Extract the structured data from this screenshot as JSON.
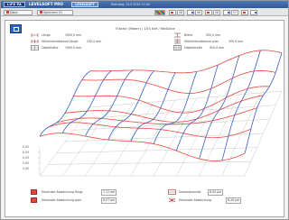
{
  "app": {
    "logo_text": "LIFE PA",
    "title": "LEVELSOFT PRO",
    "active_tab": "LEVELSOFT",
    "info": "Dienstag, 24.5.2016  11:04"
  },
  "toolbar": {
    "left_button": "Datei",
    "second_button": "Speichern",
    "second_value": "01",
    "num_fields": [
      "08",
      "06",
      "08",
      "07"
    ]
  },
  "workspace": {
    "title": "Fläche (Meter) / 155 tief / Meßlinie",
    "params_left": [
      {
        "label": "Länge",
        "value": "1995,0 mm"
      },
      {
        "label": "Stützlinienabstand Länge",
        "value": "230,0 mm"
      },
      {
        "label": "Objekthöhe",
        "value": "1995,0 mm"
      }
    ],
    "params_right": [
      {
        "label": "Breite",
        "value": "920,0 mm"
      },
      {
        "label": "Stützlinienabstand quer",
        "value": "300,0 mm"
      },
      {
        "label": "Objektbreite",
        "value": "920,0 mm"
      }
    ],
    "z_axis_labels": [
      "0,00",
      "0,00",
      "0,00",
      "0,00",
      "0,00"
    ],
    "legend_left": [
      {
        "label": "Maximale Abweichung längs",
        "value": "7,12 µm"
      },
      {
        "label": "Maximale Abweichung quer",
        "value": "8,07 µm"
      }
    ],
    "legend_right": [
      {
        "label": "Gesamtplanität",
        "value": "6,00 µm"
      },
      {
        "label": "Maximale Abweichung",
        "value": "8,40 µm"
      }
    ]
  },
  "colors": {
    "longitudinal_lines": "#e4473f",
    "transverse_lines": "#3b5fc0",
    "grid_lines": "#b0b0b0"
  },
  "icons": {
    "mode_button": "grid-view-icon",
    "param_left": "length-dimension-icon",
    "param_right": "width-dimension-icon"
  }
}
